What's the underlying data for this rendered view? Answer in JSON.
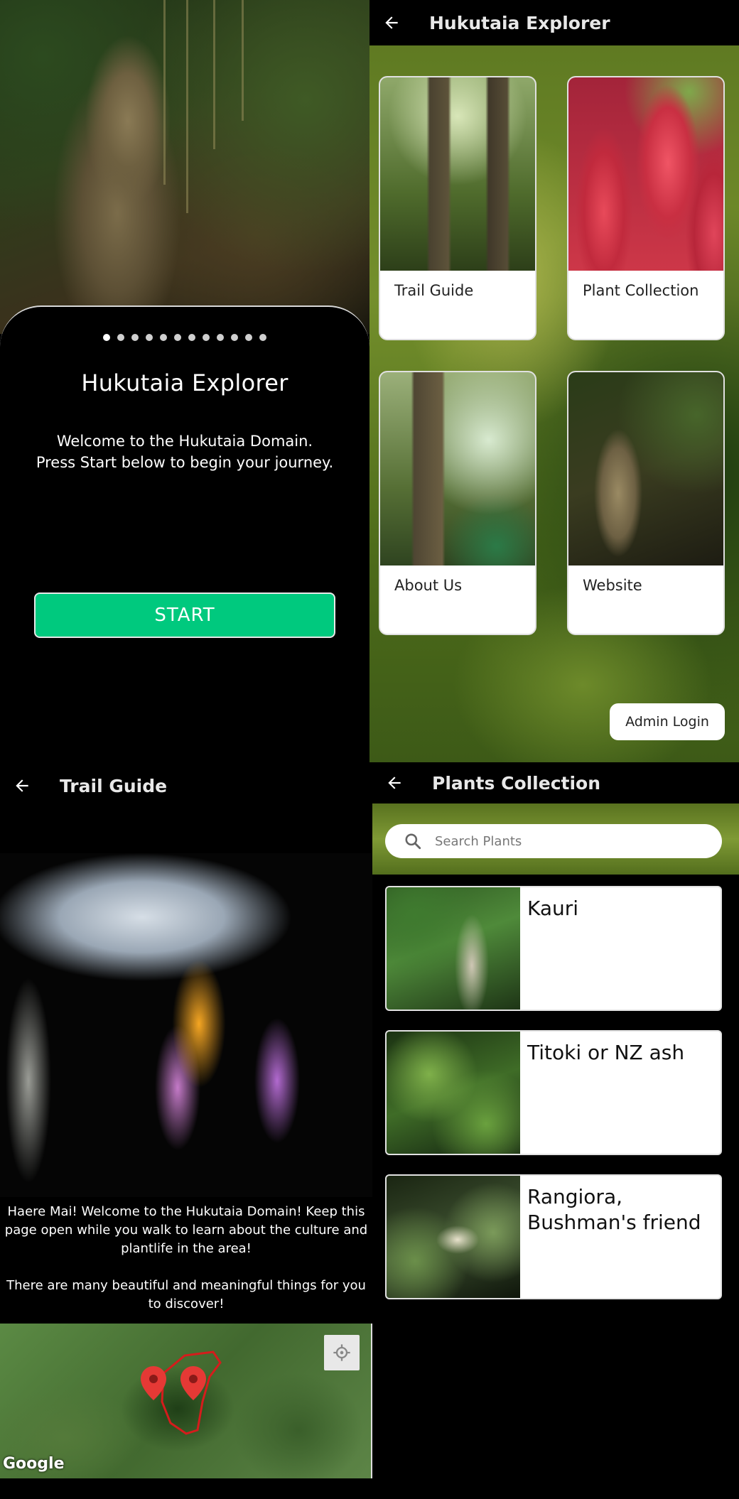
{
  "onboarding": {
    "title": "Hukutaia Explorer",
    "message_line1": "Welcome to the Hukutaia Domain.",
    "message_line2": "Press Start below to begin your journey.",
    "start_label": "START",
    "page_count": 12,
    "active_page": 1
  },
  "menu": {
    "title": "Hukutaia Explorer",
    "tiles": [
      {
        "label": "Trail Guide"
      },
      {
        "label": "Plant Collection"
      },
      {
        "label": "About Us"
      },
      {
        "label": "Website"
      }
    ],
    "admin_label": "Admin Login"
  },
  "trail": {
    "title": "Trail Guide",
    "message_line1": "Haere Mai! Welcome to the Hukutaia Domain! Keep this page open while you walk to learn about the culture and plantlife in the area!",
    "message_line2": "There are many beautiful and meaningful things for you to discover!",
    "map_logo": "Google"
  },
  "plants": {
    "title": "Plants Collection",
    "search_placeholder": "Search Plants",
    "items": [
      {
        "name": "Kauri"
      },
      {
        "name": "Titoki or NZ ash"
      },
      {
        "name": "Rangiora, Bushman's friend"
      }
    ]
  },
  "colors": {
    "accent": "#00c97e",
    "marker": "#e53935",
    "boundary": "#d51c1c"
  }
}
